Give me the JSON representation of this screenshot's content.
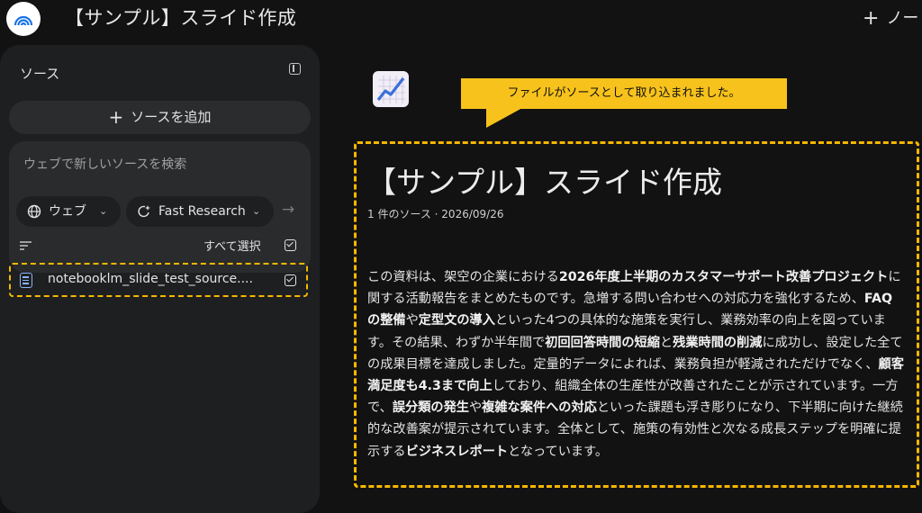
{
  "app": {
    "title": "【サンプル】スライド作成",
    "new_note_label": "ノート"
  },
  "sidebar": {
    "title": "ソース",
    "add_source_label": "ソースを追加",
    "search": {
      "placeholder": "ウェブで新しいソースを検索",
      "chip_web": "ウェブ",
      "chip_research": "Fast Research"
    },
    "select_all_label": "すべて選択",
    "sources": [
      {
        "name": "notebooklm_slide_test_source....",
        "checked": true
      }
    ]
  },
  "callout": {
    "text": "ファイルがソースとして取り込まれました。"
  },
  "note": {
    "title": "【サンプル】スライド作成",
    "meta": "1 件のソース · 2026/09/26",
    "body": [
      {
        "t": "この資料は、架空の企業における"
      },
      {
        "t": "2026年度上半期のカスタマーサポート改善プロジェクト",
        "b": true
      },
      {
        "t": "に関する活動報告をまとめたものです。急増する問い合わせへの対応力を強化するため、"
      },
      {
        "t": "FAQの整備",
        "b": true
      },
      {
        "t": "や"
      },
      {
        "t": "定型文の導入",
        "b": true
      },
      {
        "t": "といった4つの具体的な施策を実行し、業務効率の向上を図っています。その結果、わずか半年間で"
      },
      {
        "t": "初回回答時間の短縮",
        "b": true
      },
      {
        "t": "と"
      },
      {
        "t": "残業時間の削減",
        "b": true
      },
      {
        "t": "に成功し、設定した全ての成果目標を達成しました。定量的データによれば、業務負担が軽減されただけでなく、"
      },
      {
        "t": "顧客満足度も4.3まで向上",
        "b": true
      },
      {
        "t": "しており、組織全体の生産性が改善されたことが示されています。一方で、"
      },
      {
        "t": "誤分類の発生",
        "b": true
      },
      {
        "t": "や"
      },
      {
        "t": "複雑な案件への対応",
        "b": true
      },
      {
        "t": "といった課題も浮き彫りになり、下半期に向けた継続的な改善案が提示されています。全体として、施策の有効性と次なる成長ステップを明確に提示する"
      },
      {
        "t": "ビジネスレポート",
        "b": true
      },
      {
        "t": "となっています。"
      }
    ]
  },
  "colors": {
    "highlight": "#f5b800",
    "callout_bg": "#f7c21b",
    "doc_icon": "#8ab4f8"
  },
  "icons": [
    "notebooklm-logo-icon",
    "plus-icon",
    "panel-toggle-icon",
    "globe-icon",
    "chevron-down-icon",
    "research-spark-icon",
    "arrow-right-icon",
    "filter-icon",
    "checkbox-icon",
    "document-icon",
    "chart-emoji-icon"
  ]
}
